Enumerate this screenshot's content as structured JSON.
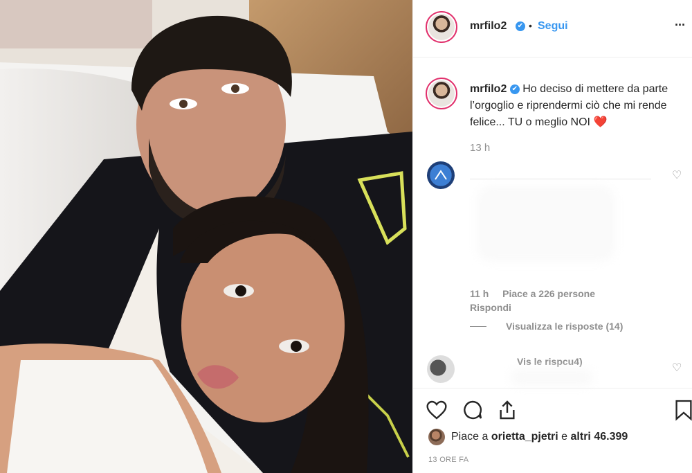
{
  "post": {
    "username": "mrfilo2",
    "verified_mark": "✔",
    "dot": "•",
    "follow_label": "Segui",
    "more_label": "···"
  },
  "caption": {
    "username": "mrfilo2",
    "text": "Ho deciso di mettere da parte l’orgoglio e riprendermi ciò che mi rende felice... TU o meglio NOI",
    "emoji": "❤️",
    "time": "13 h"
  },
  "comments": [
    {
      "time": "11 h",
      "likes": "Piace a 226 persone",
      "reply": "Rispondi",
      "view_replies": "Visualizza le risposte (14)"
    },
    {
      "partial_text": "Vis le rispcu4)"
    }
  ],
  "actions": {
    "likes_text_prefix": "Piace a ",
    "likes_user": "orietta_pjetri",
    "likes_text_mid": " e ",
    "likes_others": "altri 46.399",
    "timestamp": "13 ORE FA"
  },
  "colors": {
    "link_blue": "#3897f0",
    "heart_red": "#e0245e",
    "text_dark": "#262626",
    "text_muted": "#8e8e8e"
  }
}
